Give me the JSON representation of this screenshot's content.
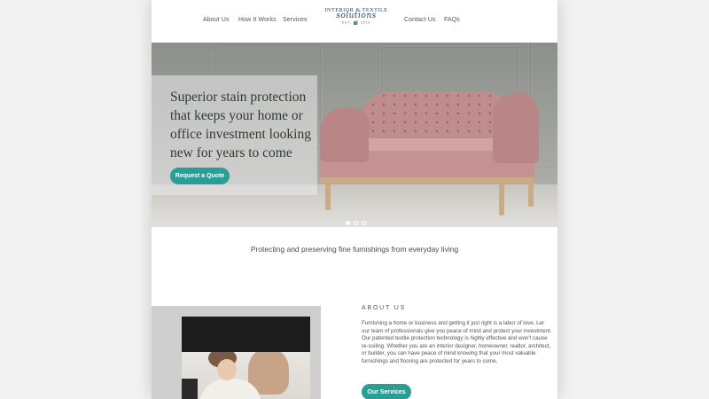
{
  "nav": {
    "left": [
      "About Us",
      "How It Works",
      "Services"
    ],
    "right": [
      "Contact Us",
      "FAQs"
    ]
  },
  "logo": {
    "top": "INTERIOR & TEXTILE",
    "script": "solutions",
    "est": "EST.",
    "year": "2019"
  },
  "hero": {
    "headline": "Superior stain protection that keeps your home or office investment looking new for years to come",
    "cta": "Request a Quote",
    "slides_total": 3,
    "active_slide": 1
  },
  "tagline": "Protecting and preserving fine furnishings from everyday living",
  "about": {
    "label": "ABOUT US",
    "body": "Furnishing a home or business and getting it just right is a labor of love. Let our team of professionals give you peace of mind and protect your investment. Our patented textile protection technology is highly effective and won't cause re-soiling. Whether you are an interior designer, homeowner, realtor, architect, or builder, you can have peace of mind knowing that your most valuable furnishings and flooring are protected for years to come.",
    "cta": "Our Services"
  },
  "colors": {
    "accent": "#2a9e94",
    "logo_navy": "#1f4470",
    "sofa_pink": "#c59293"
  }
}
